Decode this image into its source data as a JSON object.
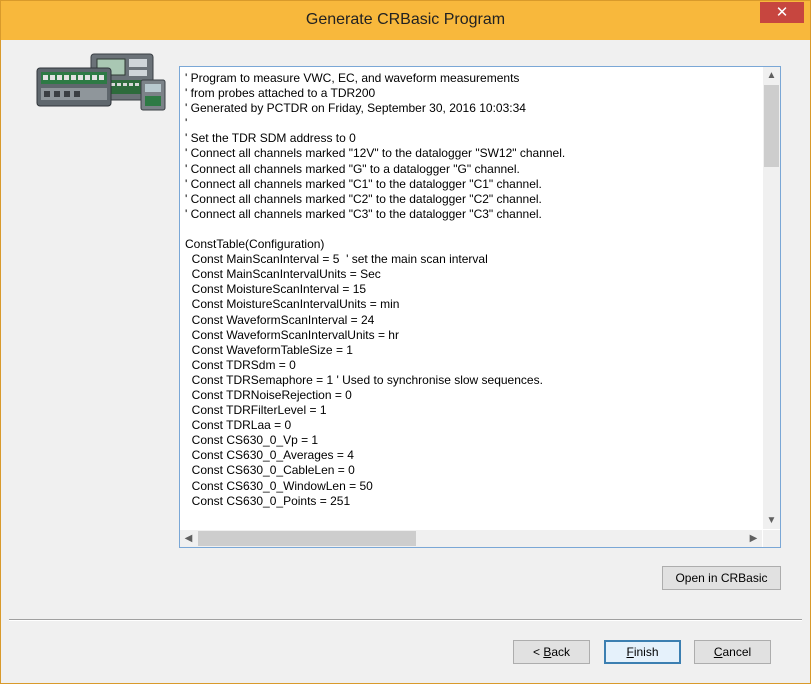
{
  "window": {
    "title": "Generate CRBasic Program",
    "close_glyph": "✕"
  },
  "code": {
    "lines": [
      "' Program to measure VWC, EC, and waveform measurements",
      "' from probes attached to a TDR200",
      "' Generated by PCTDR on Friday, September 30, 2016 10:03:34",
      "'",
      "' Set the TDR SDM address to 0",
      "' Connect all channels marked \"12V\" to the datalogger \"SW12\" channel.",
      "' Connect all channels marked \"G\" to a datalogger \"G\" channel.",
      "' Connect all channels marked \"C1\" to the datalogger \"C1\" channel.",
      "' Connect all channels marked \"C2\" to the datalogger \"C2\" channel.",
      "' Connect all channels marked \"C3\" to the datalogger \"C3\" channel.",
      "",
      "ConstTable(Configuration)",
      "  Const MainScanInterval = 5  ' set the main scan interval",
      "  Const MainScanIntervalUnits = Sec",
      "  Const MoistureScanInterval = 15",
      "  Const MoistureScanIntervalUnits = min",
      "  Const WaveformScanInterval = 24",
      "  Const WaveformScanIntervalUnits = hr",
      "  Const WaveformTableSize = 1",
      "  Const TDRSdm = 0",
      "  Const TDRSemaphore = 1 ' Used to synchronise slow sequences.",
      "  Const TDRNoiseRejection = 0",
      "  Const TDRFilterLevel = 1",
      "  Const TDRLaa = 0",
      "  Const CS630_0_Vp = 1",
      "  Const CS630_0_Averages = 4",
      "  Const CS630_0_CableLen = 0",
      "  Const CS630_0_WindowLen = 50",
      "  Const CS630_0_Points = 251"
    ]
  },
  "scrollbars": {
    "up_glyph": "▲",
    "down_glyph": "▼",
    "left_glyph": "◀",
    "right_glyph": "▶"
  },
  "buttons": {
    "open_in_crbasic": "Open in CRBasic",
    "back_mnemonic": "B",
    "back_rest": "ack",
    "back_prefix": "< ",
    "finish_mnemonic": "F",
    "finish_rest": "inish",
    "cancel_mnemonic": "C",
    "cancel_rest": "ancel"
  },
  "icons": {
    "logo": "datalogger-devices-icon"
  }
}
